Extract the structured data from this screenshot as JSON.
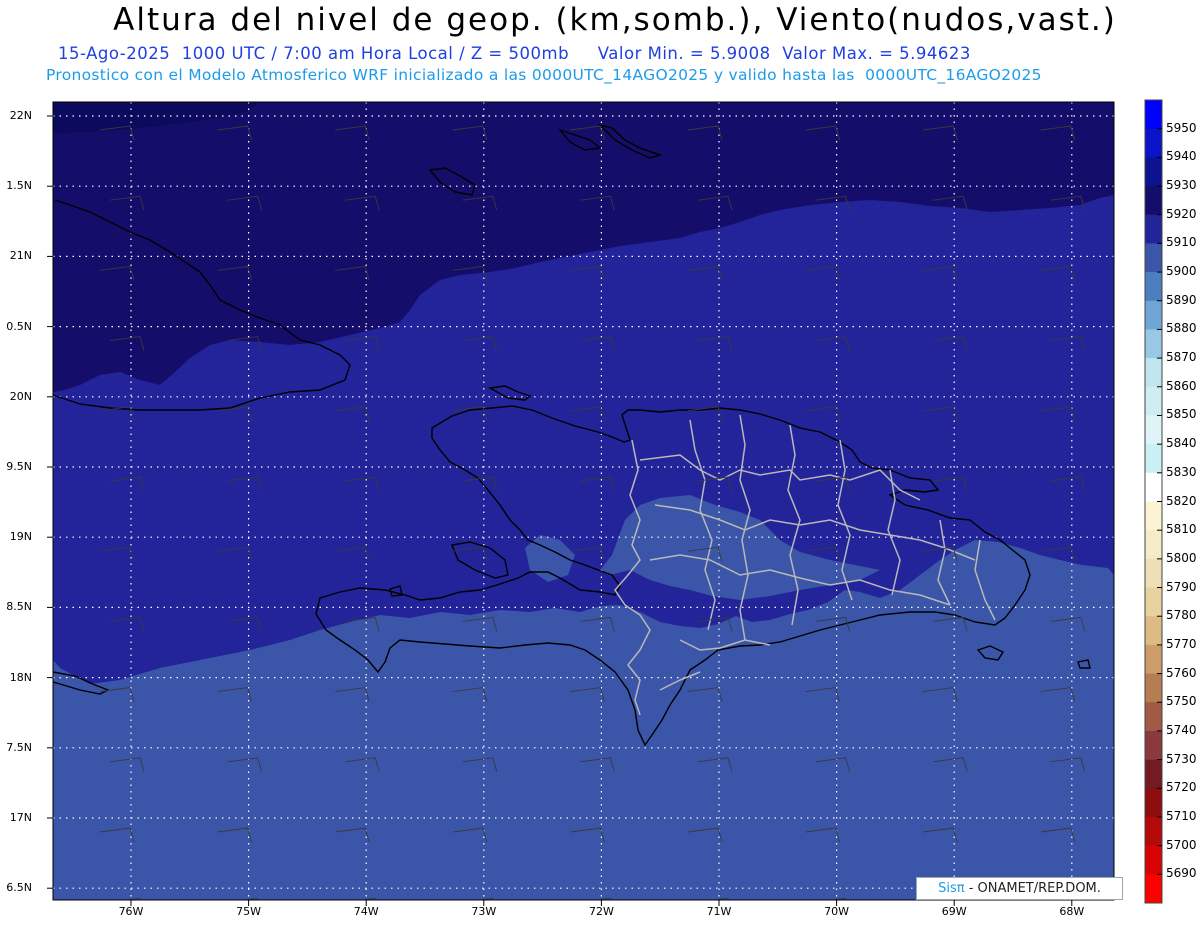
{
  "header": {
    "title": "Altura del nivel de geop. (km,somb.), Viento(nudos,vast.)",
    "date": "15-Ago-2025",
    "time": "1000 UTC / 7:00 am Hora Local / Z = 500mb",
    "min": "Valor Min. = 5.9008",
    "max": "Valor Max. = 5.94623",
    "model_info": "Pronostico con el Modelo Atmosferico WRF inicializado a las 0000UTC_14AGO2025 y valido hasta las  0000UTC_16AGO2025"
  },
  "axes": {
    "lat_labels": [
      "22N",
      "1.5N",
      "21N",
      "0.5N",
      "20N",
      "9.5N",
      "19N",
      "8.5N",
      "18N",
      "7.5N",
      "17N",
      "6.5N"
    ],
    "lon_labels": [
      "76W",
      "75W",
      "74W",
      "73W",
      "72W",
      "71W",
      "70W",
      "69W",
      "68W"
    ]
  },
  "colorbar": {
    "labels": [
      "5950",
      "5940",
      "5930",
      "5920",
      "5910",
      "5900",
      "5890",
      "5880",
      "5870",
      "5860",
      "5850",
      "5840",
      "5830",
      "5820",
      "5810",
      "5800",
      "5790",
      "5780",
      "5770",
      "5760",
      "5750",
      "5740",
      "5730",
      "5720",
      "5710",
      "5700",
      "5690"
    ],
    "colors": [
      "#0000ff",
      "#0a14c8",
      "#0c1290",
      "#140e6a",
      "#23239a",
      "#3b56a8",
      "#4d7ec0",
      "#6fa6d6",
      "#98c8e4",
      "#bfe6ef",
      "#cfeef3",
      "#dff4f7",
      "#c8f0f5",
      "#ffffff",
      "#fbf4d4",
      "#f6ebc6",
      "#efdfb6",
      "#e9d2a0",
      "#dcbb84",
      "#cc9d6a",
      "#b67c52",
      "#a05a45",
      "#8a3a3c",
      "#741a22",
      "#8e0e10",
      "#b40a0a",
      "#d80404",
      "#ff0000"
    ]
  },
  "map": {
    "colors": {
      "deep": "#140e6a",
      "mid": "#23239a",
      "light": "#3b56a8",
      "land_border": "#000000",
      "province_border": "#b8b8b8",
      "grid": "#ffffff"
    }
  },
  "credit": {
    "sis": "Sis",
    "pi": "π",
    "rest": "- ONAMET/REP.DOM."
  }
}
